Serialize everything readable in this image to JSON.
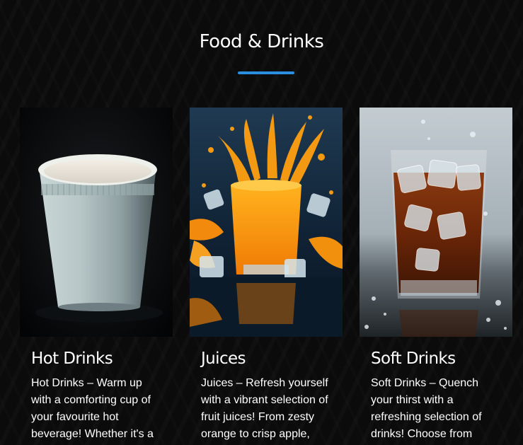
{
  "section": {
    "title": "Food & Drinks",
    "accent_color": "#2a8fe0"
  },
  "cards": [
    {
      "title": "Hot Drinks",
      "text": "Hot Drinks – Warm up with a comforting cup of your favourite hot beverage! Whether it's a",
      "image": "white-disposable-cup"
    },
    {
      "title": "Juices",
      "text": "Juices – Refresh yourself with a vibrant selection of fruit juices! From zesty orange to crisp apple,",
      "image": "orange-juice-splash"
    },
    {
      "title": "Soft Drinks",
      "text": "Soft Drinks – Quench your thirst with a refreshing selection of drinks! Choose from",
      "image": "cola-with-ice"
    }
  ]
}
